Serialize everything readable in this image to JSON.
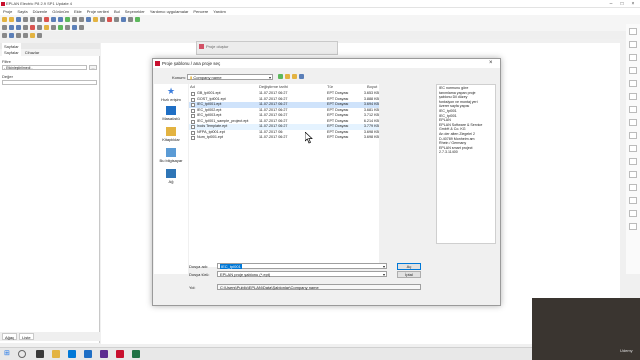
{
  "window": {
    "title": "EPLAN Electric P8 2.9 SP1 Update 4"
  },
  "menubar": [
    "Proje",
    "Sayfa",
    "Düzenle",
    "Görünüm",
    "Ekle",
    "Proje verileri",
    "Bul",
    "Seçenekler",
    "Yardımcı uygulamalar",
    "Pencere",
    "Yardım"
  ],
  "sidebar": {
    "tabs": [
      "Sayfalar",
      "Cihazlar"
    ],
    "filter_label": "Filtre",
    "filter_value": "- Etkinleştirilmedi -",
    "value_label": "Değer",
    "bottom_tabs": [
      "Ağaç",
      "Liste"
    ]
  },
  "ghost_window": {
    "title": "Proje oluştur"
  },
  "dialog": {
    "title": "Proje şablonu / ana proje seç",
    "search_label": "Konum:",
    "location": "Company name",
    "nav": [
      {
        "label": "Hızlı erişim",
        "icon": "star-icon"
      },
      {
        "label": "Masaüstü",
        "icon": "desktop-icon"
      },
      {
        "label": "Kitaplıklar",
        "icon": "library-icon"
      },
      {
        "label": "Bu bilgisayar",
        "icon": "computer-icon"
      },
      {
        "label": "Ağ",
        "icon": "network-icon"
      }
    ],
    "columns": {
      "name": "Ad",
      "date": "Değiştirme tarihi",
      "type": "Tür",
      "size": "Boyut"
    },
    "files": [
      {
        "name": "GB_tpl001.ept",
        "date": "11.07.2017 06:27",
        "type": "EPT Dosyası",
        "size": "3.653 KB"
      },
      {
        "name": "GOST_tpl001.ept",
        "date": "11.07.2017 06:27",
        "type": "EPT Dosyası",
        "size": "3.888 KB"
      },
      {
        "name": "IEC_tpl001.ept",
        "date": "11.07.2017 06:27",
        "type": "EPT Dosyası",
        "size": "3.694 KB"
      },
      {
        "name": "IEC_tpl002.ept",
        "date": "11.07.2017 06:27",
        "type": "EPT Dosyası",
        "size": "3.681 KB"
      },
      {
        "name": "IEC_tpl003.ept",
        "date": "11.07.2017 06:27",
        "type": "EPT Dosyası",
        "size": "3.712 KB"
      },
      {
        "name": "IEC_tpl001_sample_project.ept",
        "date": "11.07.2017 06:27",
        "type": "EPT Dosyası",
        "size": "6.214 KB"
      },
      {
        "name": "Irods Template.ept",
        "date": "11.07.2017 06:27",
        "type": "EPT Dosyası",
        "size": "3.779 KB"
      },
      {
        "name": "NFPA_tpl001.ept",
        "date": "11.07.2017 06:",
        "type": "EPT Dosyası",
        "size": "3.698 KB"
      },
      {
        "name": "Num_tpl001.ept",
        "date": "11.07.2017 06:27",
        "type": "EPT Dosyası",
        "size": "3.698 KB"
      }
    ],
    "preview": [
      "IEC normunu göre",
      "tanımlama yapan proje",
      "şablonu Dil düzey",
      "fonksiyon ve montaj yeri",
      "üzerer sayfa yapısı",
      "IEC_tpl001",
      "IEC_tpl001",
      "EPLAN",
      "EPLAN Software & Service",
      "GmbH & Co. KG",
      "An der alten Ziegelei 2",
      "D-40789 Monheim am",
      "Rhein / Germany",
      "EPLAN smart project",
      "2.7.3.11400"
    ],
    "filename_label": "Dosya adı:",
    "filename_value": "IEC_tpl001",
    "filetype_label": "Dosya türü:",
    "filetype_value": "EPLAN proje şablonu (*.ept)",
    "path_label": "Yol:",
    "path_value": "C:\\Users\\Public\\EPLAN\\Data\\Şablonlar\\Company name",
    "open_label": "Aç",
    "cancel_label": "İptal"
  },
  "webcam": {
    "brand": "Udemy"
  },
  "colors": {
    "eplan_red": "#c8102e",
    "selection": "#cfe3fb",
    "accent": "#0078d7"
  }
}
